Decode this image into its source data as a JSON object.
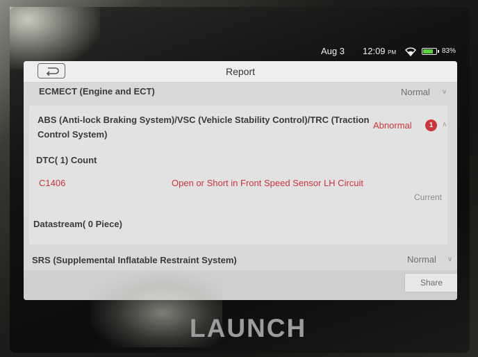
{
  "status_bar": {
    "date": "Aug 3",
    "time": "12:09",
    "meridiem": "PM",
    "battery": "83%",
    "battery_level": 0.83,
    "battery_color": "#59d13a"
  },
  "header": {
    "title": "Report",
    "back_icon": "back-arrow-icon"
  },
  "systems": [
    {
      "name": "ECMECT (Engine and ECT)",
      "status": "Normal"
    },
    {
      "name": "ABS (Anti-lock Braking System)/VSC (Vehicle Stability Control)/TRC (Traction Control System)",
      "status": "Abnormal",
      "fault_count": "1",
      "dtc_header": "DTC( 1) Count",
      "dtcs": [
        {
          "code": "C1406",
          "description": "Open or Short in Front Speed Sensor LH Circuit",
          "state": "Current"
        }
      ],
      "datastream_header": "Datastream( 0 Piece)"
    },
    {
      "name": "SRS (Supplemental Inflatable Restraint System)",
      "status": "Normal"
    }
  ],
  "footer": {
    "share_label": "Share"
  },
  "brand": "LAUNCH",
  "colors": {
    "abnormal": "#c9363c",
    "normal": "#6e6e6e"
  }
}
